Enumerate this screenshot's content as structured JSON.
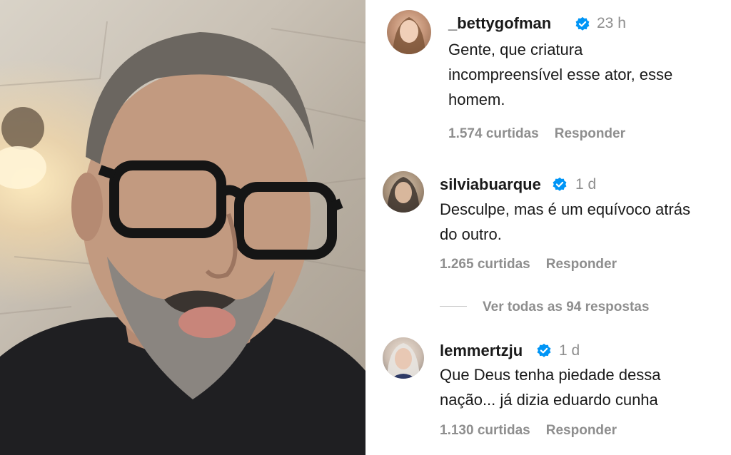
{
  "comments": [
    {
      "username": "_bettygofman",
      "verified_icon": "verified-badge-icon",
      "time": "23 h",
      "text_lines": [
        "Gente, que criatura",
        "incompreensível esse ator, esse",
        "homem."
      ],
      "likes": "1.574 curtidas",
      "reply": "Responder"
    },
    {
      "username": "silviabuarque",
      "verified_icon": "verified-badge-icon",
      "time": "1 d",
      "text_lines": [
        "Desculpe, mas é um equívoco atrás",
        "do outro."
      ],
      "likes": "1.265 curtidas",
      "reply": "Responder"
    },
    {
      "username": "lemmertzju",
      "verified_icon": "verified-badge-icon",
      "time": "1 d",
      "text_lines": [
        "Que Deus tenha piedade dessa",
        "nação... já dizia eduardo cunha"
      ],
      "likes": "1.130 curtidas",
      "reply": "Responder"
    }
  ],
  "view_replies": "Ver todas as 94 respostas",
  "colors": {
    "verified": "#0095f6",
    "secondary_text": "#8e8e8e",
    "primary_text": "#1a1a1a"
  }
}
